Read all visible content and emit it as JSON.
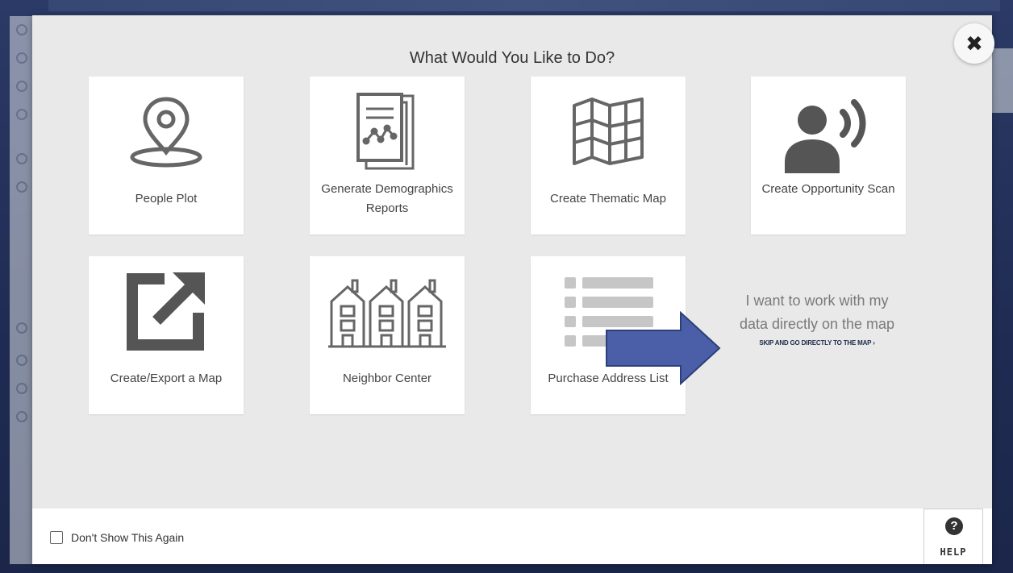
{
  "modal": {
    "title": "What Would You Like to Do?",
    "close_icon": "close-icon"
  },
  "options": [
    {
      "label": "People Plot",
      "icon": "map-pin-icon"
    },
    {
      "label": "Generate Demographics Reports",
      "icon": "report-chart-icon"
    },
    {
      "label": "Create Thematic Map",
      "icon": "folded-map-icon"
    },
    {
      "label": "Create Opportunity Scan",
      "icon": "person-broadcast-icon"
    },
    {
      "label": "Create/Export a Map",
      "icon": "export-arrow-icon"
    },
    {
      "label": "Neighbor Center",
      "icon": "houses-icon"
    },
    {
      "label": "Purchase Address List",
      "icon": "list-icon"
    }
  ],
  "direct": {
    "text": "I want to work with my data directly on the map",
    "link": "SKIP AND GO DIRECTLY TO THE MAP ›"
  },
  "footer": {
    "dont_show_label": "Don't Show This Again",
    "dont_show_checked": false,
    "help_label": "HELP",
    "help_icon": "?"
  },
  "colors": {
    "modal_bg": "#e9e9e9",
    "card_bg": "#ffffff",
    "icon": "#666666",
    "annotation_arrow": "#4a5fa8"
  }
}
